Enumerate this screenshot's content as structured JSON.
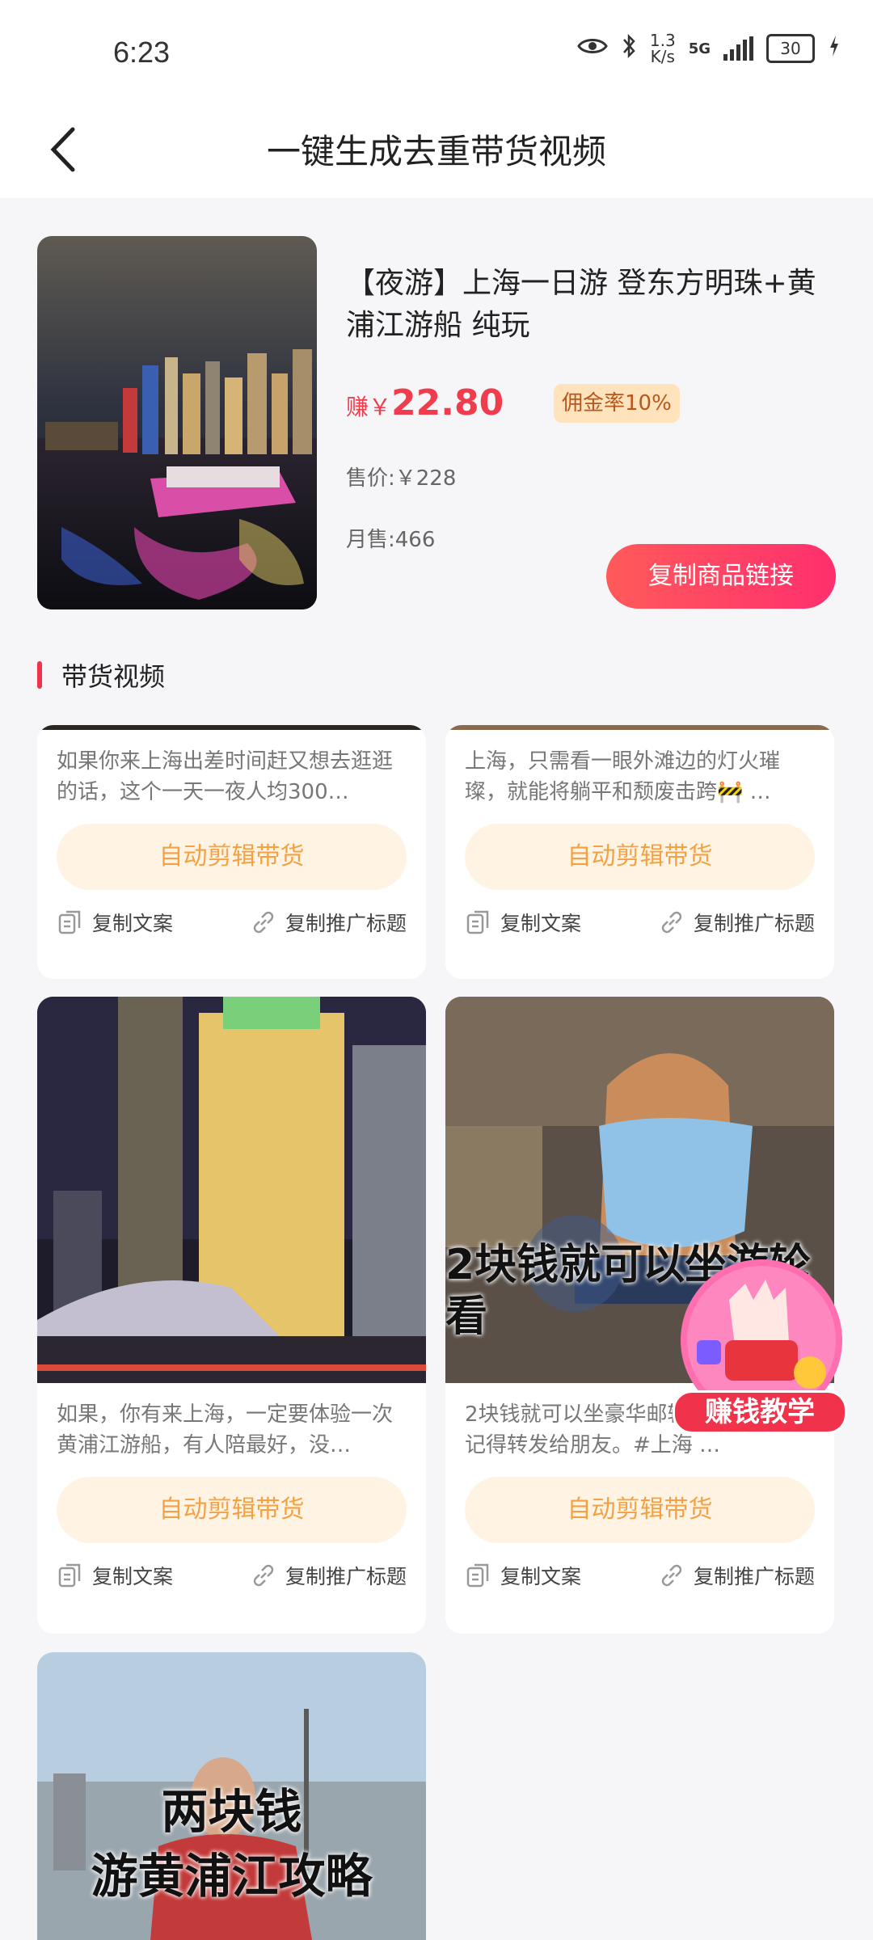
{
  "status": {
    "time": "6:23",
    "speed_top": "1.3",
    "speed_bottom": "K/s",
    "network": "5G",
    "battery": "30"
  },
  "header": {
    "title": "一键生成去重带货视频"
  },
  "product": {
    "name": "【夜游】上海一日游 登东方明珠+黄浦江游船 纯玩",
    "earn_prefix": "赚￥",
    "earn_amount": "22.80",
    "commission": "佣金率10%",
    "price": "售价:￥228",
    "monthly_sales": "月售:466",
    "copy_link_label": "复制商品链接"
  },
  "section": {
    "title": "带货视频"
  },
  "videos": [
    {
      "desc": "如果你来上海出差时间赶又想去逛逛的话，这个一天一夜人均300…",
      "auto": "自动剪辑带货",
      "copy_text": "复制文案",
      "copy_title": "复制推广标题"
    },
    {
      "desc": "上海，只需看一眼外滩边的灯火璀璨，就能将躺平和颓废击跨🚧 …",
      "auto": "自动剪辑带货",
      "copy_text": "复制文案",
      "copy_title": "复制推广标题"
    },
    {
      "desc": "如果，你有来上海，一定要体验一次黄浦江游船，有人陪最好，没…",
      "auto": "自动剪辑带货",
      "copy_text": "复制文案",
      "copy_title": "复制推广标题"
    },
    {
      "desc": "2块钱就可以坐豪华邮轮看上海夜景。记得转发给朋友。#上海 …",
      "overlay": "2块钱就可以坐游轮看",
      "auto": "自动剪辑带货",
      "copy_text": "复制文案",
      "copy_title": "复制推广标题"
    },
    {
      "overlay_line1": "两块钱",
      "overlay_line2": "游黄浦江攻略"
    }
  ],
  "promo": {
    "label": "赚钱教学"
  },
  "colors": {
    "accent": "#f0334a",
    "commission_bg": "#ffe3bd",
    "auto_bg": "#fff4e4",
    "auto_text": "#f4a143"
  }
}
